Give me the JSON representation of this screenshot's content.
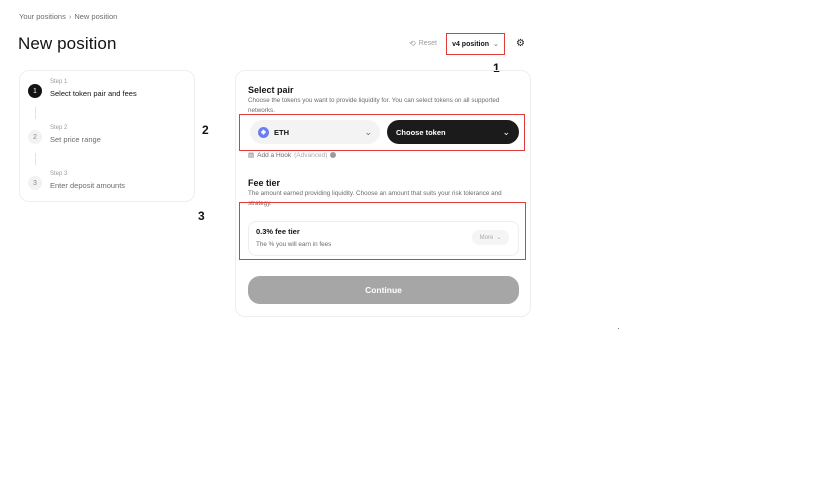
{
  "breadcrumb": {
    "parent": "Your positions",
    "separator": "›",
    "current": "New position"
  },
  "page_title": "New position",
  "header": {
    "reset_label": "Reset",
    "version_label": "v4 position"
  },
  "markers": [
    "1",
    "2",
    "3"
  ],
  "steps": [
    {
      "label": "Step 1",
      "title": "Select token pair and fees",
      "number": "1"
    },
    {
      "label": "Step 2",
      "title": "Set price range",
      "number": "2"
    },
    {
      "label": "Step 3",
      "title": "Enter deposit amounts",
      "number": "3"
    }
  ],
  "select_pair": {
    "title": "Select pair",
    "description": "Choose the tokens you want to provide liquidity for. You can select tokens on all supported networks.",
    "token_a": "ETH",
    "token_b": "Choose token",
    "hook_label": "Add a Hook",
    "hook_tag": "(Advanced)"
  },
  "fee_tier": {
    "title": "Fee tier",
    "description": "The amount earned providing liquidity. Choose an amount that suits your risk tolerance and strategy.",
    "selected": "0.3% fee tier",
    "selected_desc": "The % you will earn in fees",
    "more_label": "More"
  },
  "continue_label": "Continue",
  "colors": {
    "highlight": "#e23b3b",
    "eth": "#6b7ff0",
    "button_disabled": "#a6a6a6"
  }
}
